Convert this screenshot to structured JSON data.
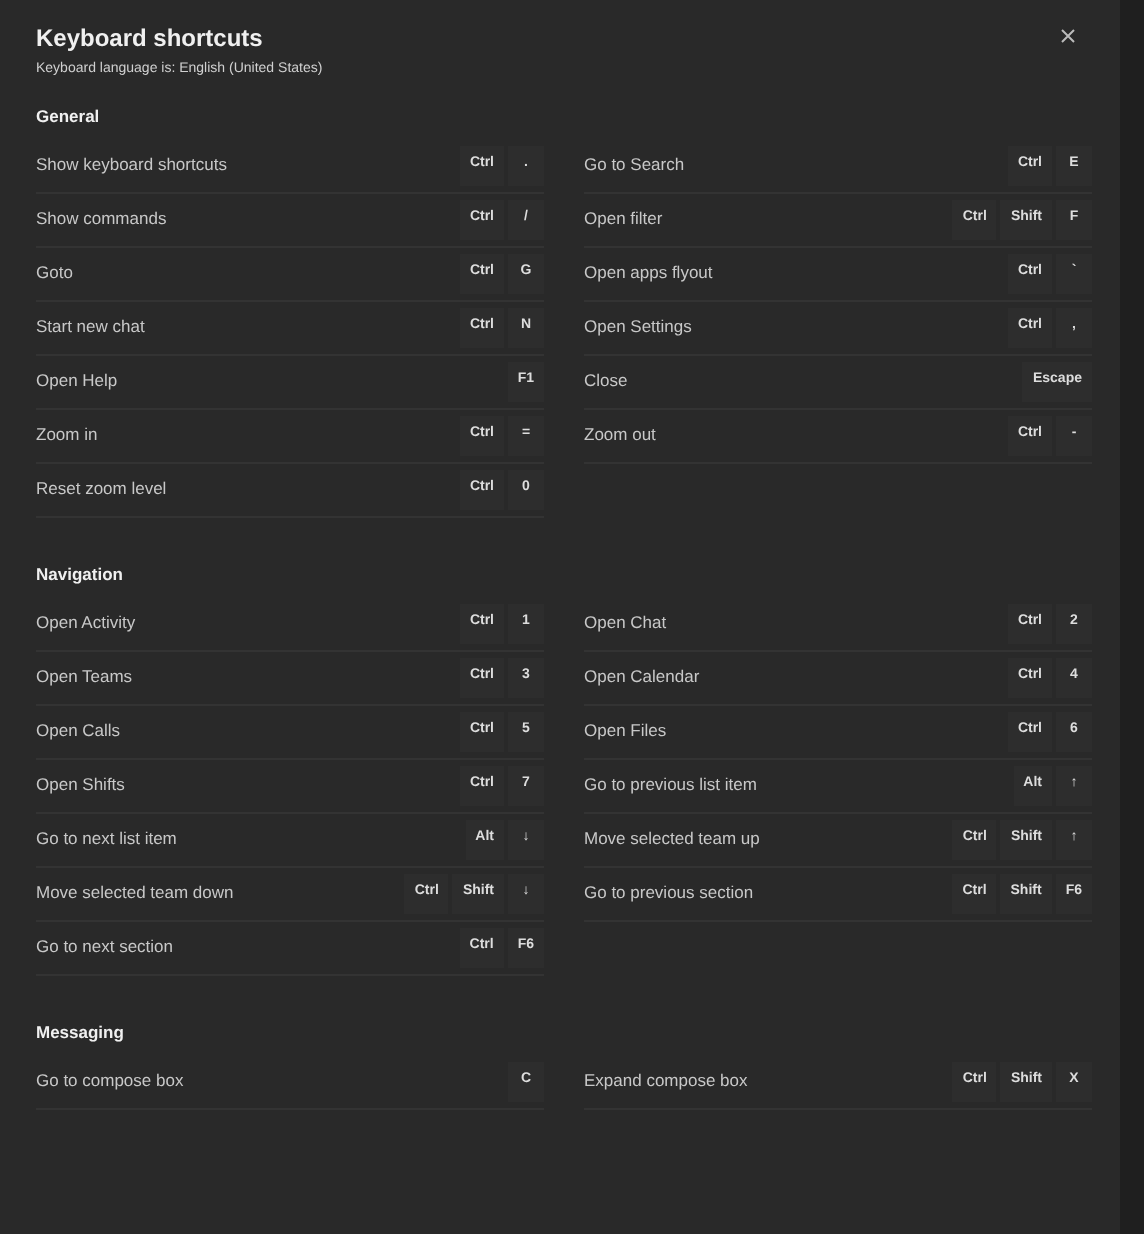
{
  "dialog": {
    "title": "Keyboard shortcuts",
    "subtitle": "Keyboard language is: English (United States)"
  },
  "sections": [
    {
      "heading": "General",
      "shortcuts": [
        {
          "label": "Show keyboard shortcuts",
          "keys": [
            "Ctrl",
            "."
          ]
        },
        {
          "label": "Go to Search",
          "keys": [
            "Ctrl",
            "E"
          ]
        },
        {
          "label": "Show commands",
          "keys": [
            "Ctrl",
            "/"
          ]
        },
        {
          "label": "Open filter",
          "keys": [
            "Ctrl",
            "Shift",
            "F"
          ]
        },
        {
          "label": "Goto",
          "keys": [
            "Ctrl",
            "G"
          ]
        },
        {
          "label": "Open apps flyout",
          "keys": [
            "Ctrl",
            "`"
          ]
        },
        {
          "label": "Start new chat",
          "keys": [
            "Ctrl",
            "N"
          ]
        },
        {
          "label": "Open Settings",
          "keys": [
            "Ctrl",
            ","
          ]
        },
        {
          "label": "Open Help",
          "keys": [
            "F1"
          ]
        },
        {
          "label": "Close",
          "keys": [
            "Escape"
          ]
        },
        {
          "label": "Zoom in",
          "keys": [
            "Ctrl",
            "="
          ]
        },
        {
          "label": "Zoom out",
          "keys": [
            "Ctrl",
            "-"
          ]
        },
        {
          "label": "Reset zoom level",
          "keys": [
            "Ctrl",
            "0"
          ]
        }
      ]
    },
    {
      "heading": "Navigation",
      "shortcuts": [
        {
          "label": "Open Activity",
          "keys": [
            "Ctrl",
            "1"
          ]
        },
        {
          "label": "Open Chat",
          "keys": [
            "Ctrl",
            "2"
          ]
        },
        {
          "label": "Open Teams",
          "keys": [
            "Ctrl",
            "3"
          ]
        },
        {
          "label": "Open Calendar",
          "keys": [
            "Ctrl",
            "4"
          ]
        },
        {
          "label": "Open Calls",
          "keys": [
            "Ctrl",
            "5"
          ]
        },
        {
          "label": "Open Files",
          "keys": [
            "Ctrl",
            "6"
          ]
        },
        {
          "label": "Open Shifts",
          "keys": [
            "Ctrl",
            "7"
          ]
        },
        {
          "label": "Go to previous list item",
          "keys": [
            "Alt",
            "↑"
          ]
        },
        {
          "label": "Go to next list item",
          "keys": [
            "Alt",
            "↓"
          ]
        },
        {
          "label": "Move selected team up",
          "keys": [
            "Ctrl",
            "Shift",
            "↑"
          ]
        },
        {
          "label": "Move selected team down",
          "keys": [
            "Ctrl",
            "Shift",
            "↓"
          ]
        },
        {
          "label": "Go to previous section",
          "keys": [
            "Ctrl",
            "Shift",
            "F6"
          ]
        },
        {
          "label": "Go to next section",
          "keys": [
            "Ctrl",
            "F6"
          ]
        }
      ]
    },
    {
      "heading": "Messaging",
      "shortcuts": [
        {
          "label": "Go to compose box",
          "keys": [
            "C"
          ]
        },
        {
          "label": "Expand compose box",
          "keys": [
            "Ctrl",
            "Shift",
            "X"
          ]
        }
      ]
    }
  ]
}
